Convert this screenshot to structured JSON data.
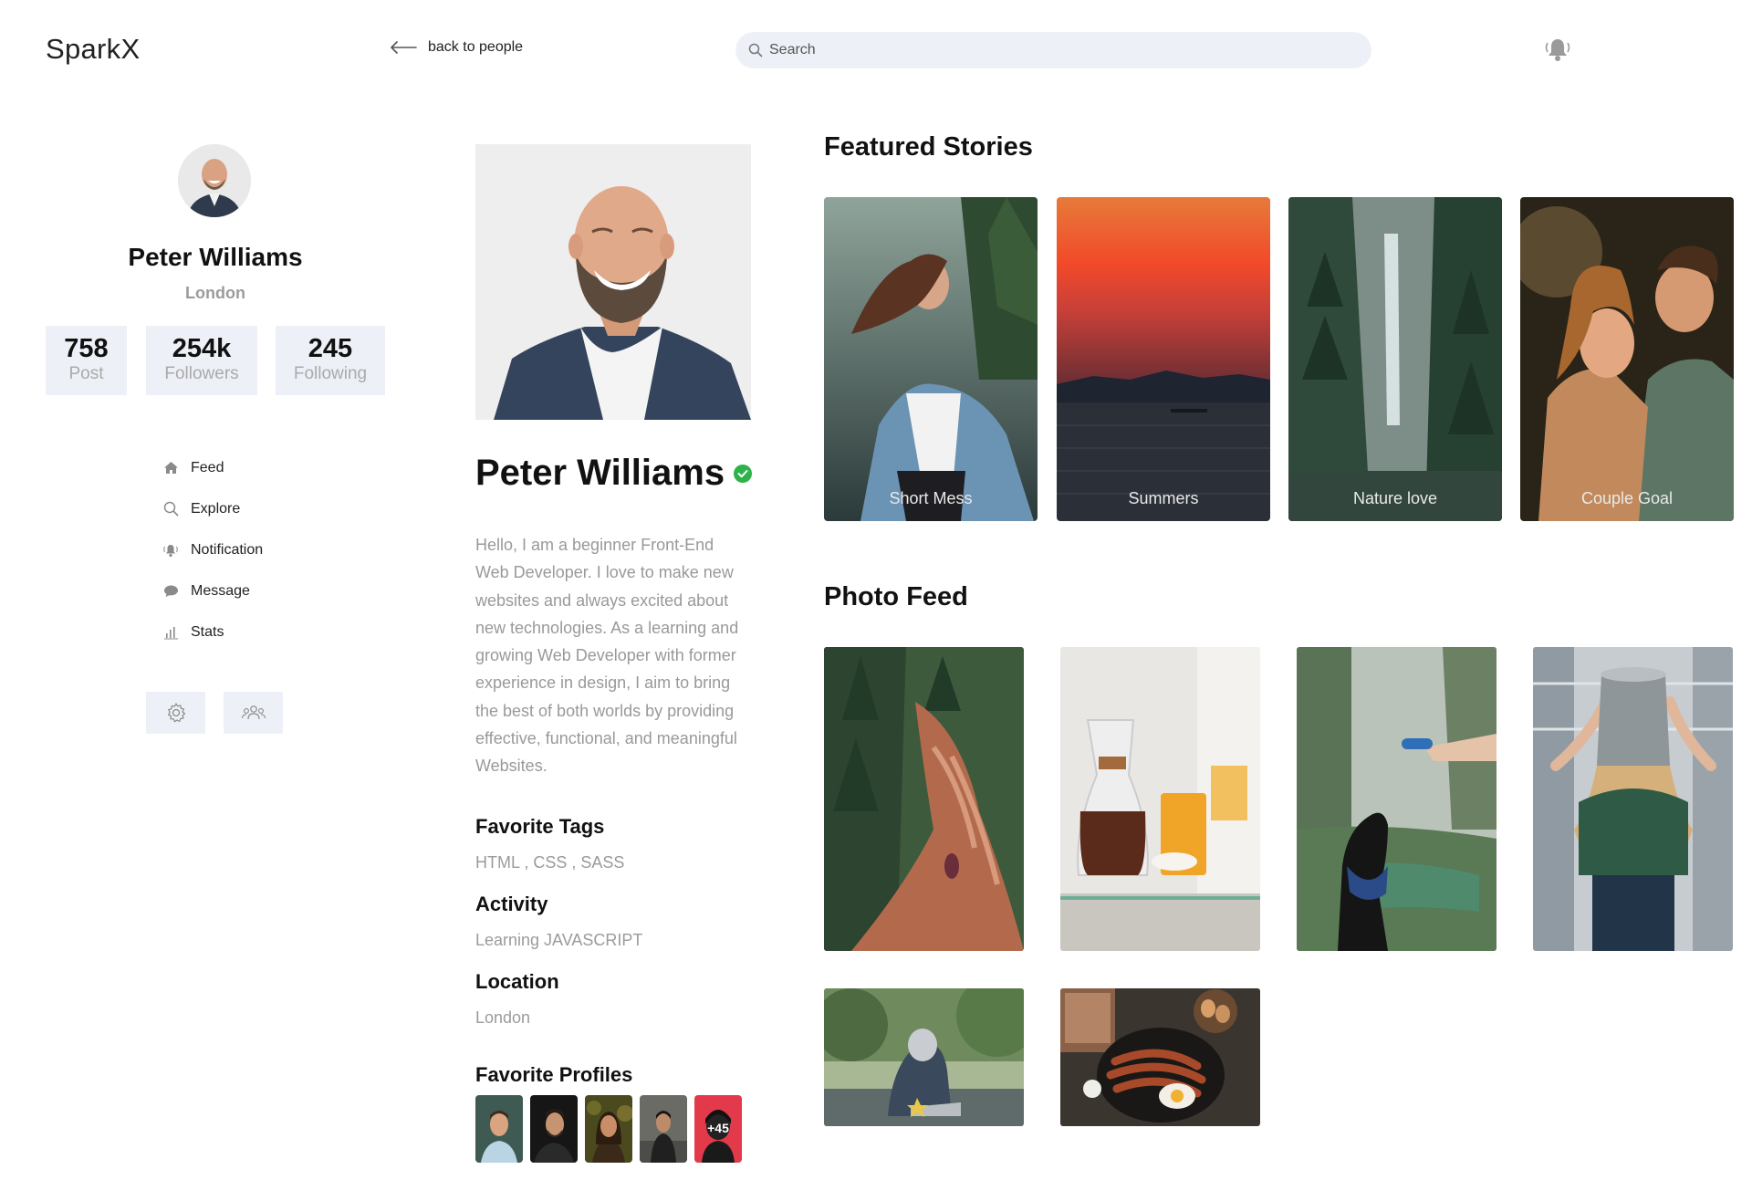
{
  "header": {
    "logo": "SparkX",
    "back_label": "back to people",
    "search_placeholder": "Search"
  },
  "sidebar": {
    "name": "Peter Williams",
    "city": "London",
    "stats": [
      {
        "value": "758",
        "label": "Post"
      },
      {
        "value": "254k",
        "label": "Followers"
      },
      {
        "value": "245",
        "label": "Following"
      }
    ],
    "nav": [
      {
        "label": "Feed",
        "icon": "home-icon"
      },
      {
        "label": "Explore",
        "icon": "search-icon"
      },
      {
        "label": "Notification",
        "icon": "bell-icon"
      },
      {
        "label": "Message",
        "icon": "chat-bubble-icon"
      },
      {
        "label": "Stats",
        "icon": "bar-chart-icon"
      }
    ],
    "tools": [
      "gear-icon",
      "group-icon"
    ]
  },
  "profile": {
    "name": "Peter Williams",
    "bio": "Hello, I am a beginner Front-End Web Developer. I love to make new websites and always excited about new technologies. As a learning and growing Web Developer with former experience in design, I aim to bring the best of both worlds by providing effective, functional, and meaningful Websites.",
    "sections": [
      {
        "title": "Favorite Tags",
        "value": "HTML , CSS , SASS"
      },
      {
        "title": "Activity",
        "value": "Learning JAVASCRIPT"
      },
      {
        "title": "Location",
        "value": "London"
      }
    ],
    "favorites_title": "Favorite Profiles",
    "favorites_more": "+45"
  },
  "feed": {
    "featured_title": "Featured Stories",
    "stories": [
      {
        "caption": "Short Mess"
      },
      {
        "caption": "Summers"
      },
      {
        "caption": "Nature love"
      },
      {
        "caption": "Couple Goal"
      }
    ],
    "photo_title": "Photo Feed",
    "photo_count": 6
  },
  "colors": {
    "panel": "#edf1f7",
    "verified": "#2db34a",
    "muted_text": "#999999"
  }
}
